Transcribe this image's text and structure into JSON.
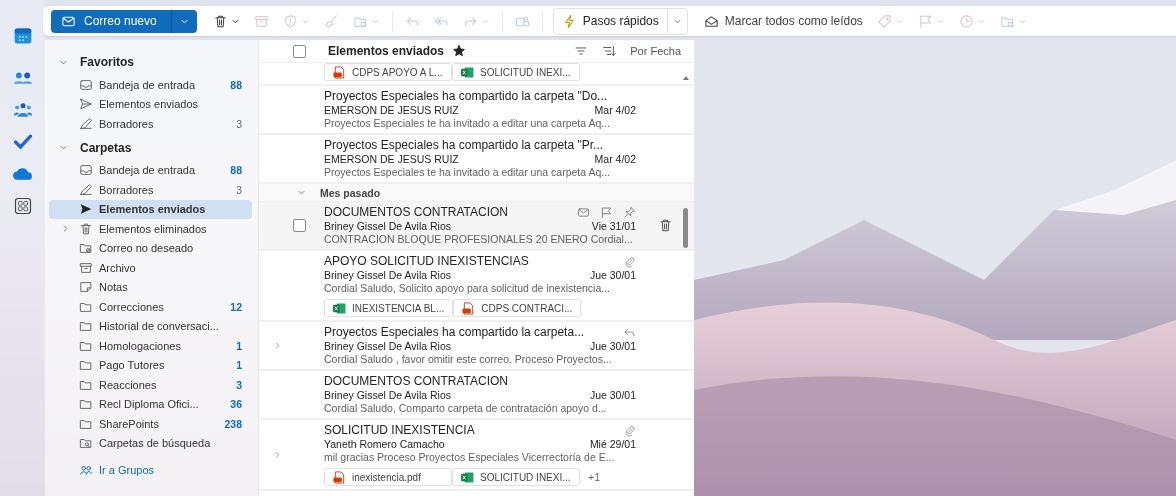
{
  "rail": [
    {
      "kind": "calendar",
      "selected": false
    },
    {
      "kind": "people",
      "selected": false
    },
    {
      "kind": "groups",
      "selected": false
    },
    {
      "kind": "todo",
      "selected": false
    },
    {
      "kind": "cloud",
      "selected": false
    },
    {
      "kind": "apps",
      "selected": false
    }
  ],
  "toolbar": {
    "new_mail": {
      "label": "Correo nuevo"
    },
    "actions": [
      {
        "kind": "delete",
        "disabled": false,
        "dropdown": true
      },
      {
        "kind": "archive",
        "disabled": true,
        "dropdown": false
      },
      {
        "kind": "report",
        "disabled": true,
        "dropdown": true
      },
      {
        "kind": "sweep",
        "disabled": true,
        "dropdown": false
      },
      {
        "kind": "move",
        "disabled": true,
        "dropdown": true
      },
      {
        "kind": "reply",
        "disabled": true,
        "dropdown": false
      },
      {
        "kind": "replyall",
        "disabled": true,
        "dropdown": false
      },
      {
        "kind": "forward",
        "disabled": true,
        "dropdown": true
      },
      {
        "kind": "teams",
        "disabled": true,
        "dropdown": false
      }
    ],
    "quick_steps": {
      "label": "Pasos rápidos"
    },
    "mark_all_read": {
      "label": "Marcar todos como leídos"
    },
    "more_actions": [
      {
        "kind": "tag",
        "disabled": true,
        "dropdown": true
      },
      {
        "kind": "flag",
        "disabled": true,
        "dropdown": true
      },
      {
        "kind": "clock",
        "disabled": true,
        "dropdown": true
      },
      {
        "kind": "move",
        "disabled": true,
        "dropdown": true
      }
    ]
  },
  "folders": {
    "sections": [
      {
        "title": "Favoritos",
        "expanded": true,
        "items": [
          {
            "kind": "inbox",
            "label": "Bandeja de entrada",
            "count": "88",
            "selected": false,
            "collapsed_children": false
          },
          {
            "kind": "sent",
            "label": "Elementos enviados",
            "selected": false,
            "collapsed_children": false
          },
          {
            "kind": "drafts",
            "label": "Borradores",
            "count": "3",
            "count_muted": true,
            "selected": false,
            "collapsed_children": false
          }
        ]
      },
      {
        "title": "Carpetas",
        "expanded": true,
        "items": [
          {
            "kind": "inbox",
            "label": "Bandeja de entrada",
            "count": "88",
            "selected": false,
            "collapsed_children": false
          },
          {
            "kind": "drafts",
            "label": "Borradores",
            "count": "3",
            "count_muted": true,
            "selected": false,
            "collapsed_children": false
          },
          {
            "kind": "sent",
            "label": "Elementos enviados",
            "selected": true,
            "collapsed_children": false
          },
          {
            "kind": "deleted",
            "label": "Elementos eliminados",
            "selected": false,
            "collapsed_children": true
          },
          {
            "kind": "junk",
            "label": "Correo no deseado",
            "selected": false,
            "collapsed_children": false
          },
          {
            "kind": "archive",
            "label": "Archivo",
            "selected": false,
            "collapsed_children": false
          },
          {
            "kind": "notes",
            "label": "Notas",
            "selected": false,
            "collapsed_children": false
          },
          {
            "kind": "folder",
            "label": "Correcciones",
            "count": "12",
            "selected": false,
            "collapsed_children": false
          },
          {
            "kind": "folder",
            "label": "Historial de conversaci...",
            "selected": false,
            "collapsed_children": false
          },
          {
            "kind": "folder",
            "label": "Homologaciones",
            "count": "1",
            "selected": false,
            "collapsed_children": false
          },
          {
            "kind": "folder",
            "label": "Pago Tutores",
            "count": "1",
            "selected": false,
            "collapsed_children": false
          },
          {
            "kind": "folder",
            "label": "Reacciones",
            "count": "3",
            "selected": false,
            "collapsed_children": false
          },
          {
            "kind": "folder",
            "label": "Recl Diploma Ofici...",
            "count": "36",
            "selected": false,
            "collapsed_children": false
          },
          {
            "kind": "folder",
            "label": "SharePoints",
            "count": "238",
            "selected": false,
            "collapsed_children": false
          },
          {
            "kind": "search",
            "label": "Carpetas de búsqueda",
            "selected": false,
            "collapsed_children": false
          }
        ]
      }
    ],
    "groups_link": "Ir a Grupos"
  },
  "message_list": {
    "title": "Elementos enviados",
    "select_all_checked": false,
    "favorite": true,
    "sort_label": "Por Fecha",
    "partial_attachments": [
      {
        "kind": "pdf",
        "name": "CDPS APOYO A L..."
      },
      {
        "kind": "excel",
        "name": "SOLICITUD INEXI..."
      }
    ],
    "groups": [
      {
        "messages": [
          {
            "subject": "Proyectos Especiales ha compartido la carpeta \"Do...",
            "sender": "EMERSON DE JESUS RUIZ",
            "date": "Mar 4/02",
            "preview": "Proyectos Especiales te ha invitado a editar una carpeta Aq...",
            "expandable": false,
            "hovered": false,
            "checked": false,
            "attachment": false,
            "replied": false
          },
          {
            "subject": "Proyectos Especiales ha compartido la carpeta \"Pr...",
            "sender": "EMERSON DE JESUS RUIZ",
            "date": "Mar 4/02",
            "preview": "Proyectos Especiales te ha invitado a editar una carpeta Aq...",
            "expandable": false,
            "hovered": false,
            "checked": false,
            "attachment": false,
            "replied": false
          }
        ]
      },
      {
        "header": "Mes pasado",
        "expanded": true,
        "messages": [
          {
            "subject": "DOCUMENTOS CONTRATACION",
            "sender": "Briney Gissel De Avila Rios",
            "date": "Vie 31/01",
            "preview": "CONTRACION BLOQUE PROFESIONALES 20 ENERO Cordial...",
            "expandable": false,
            "hovered": true,
            "checked": false,
            "attachment": false,
            "replied": false
          },
          {
            "subject": "APOYO SOLICITUD INEXISTENCIAS",
            "sender": "Briney Gissel De Avila Rios",
            "date": "Jue 30/01",
            "preview": "Cordial Saludo, Solicito apoyo para solicitud de inexistencia...",
            "expandable": false,
            "hovered": false,
            "checked": false,
            "attachment": true,
            "replied": false,
            "attachments": [
              {
                "kind": "excel",
                "name": "INEXISTENCIA BL..."
              },
              {
                "kind": "pdf",
                "name": "CDPS CONTRACI..."
              }
            ]
          },
          {
            "subject": "Proyectos Especiales ha compartido la carpeta...",
            "sender": "Briney Gissel De Avila Rios",
            "date": "Jue 30/01",
            "preview": "Cordial Saludo , favor omitir este correo. Proceso Proyectos...",
            "expandable": true,
            "hovered": false,
            "checked": false,
            "attachment": false,
            "replied": true
          },
          {
            "subject": "DOCUMENTOS CONTRATACION",
            "sender": "Briney Gissel De Avila Rios",
            "date": "Jue 30/01",
            "preview": "Cordial Saludo, Comparto carpeta de contratación apoyo d...",
            "expandable": false,
            "hovered": false,
            "checked": false,
            "attachment": false,
            "replied": false
          },
          {
            "subject": "SOLICITUD INEXISTENCIA",
            "sender": "Yaneth Romero Camacho",
            "date": "Mié 29/01",
            "preview": "mil gracias Proceso Proyectos Especiales Vicerrectoría de E...",
            "expandable": true,
            "hovered": false,
            "checked": false,
            "attachment": true,
            "replied": false,
            "attachments": [
              {
                "kind": "pdf",
                "name": "inexistencia.pdf"
              },
              {
                "kind": "excel",
                "name": "SOLICITUD INEXI..."
              }
            ],
            "more_attachments": "+1"
          }
        ]
      }
    ]
  }
}
